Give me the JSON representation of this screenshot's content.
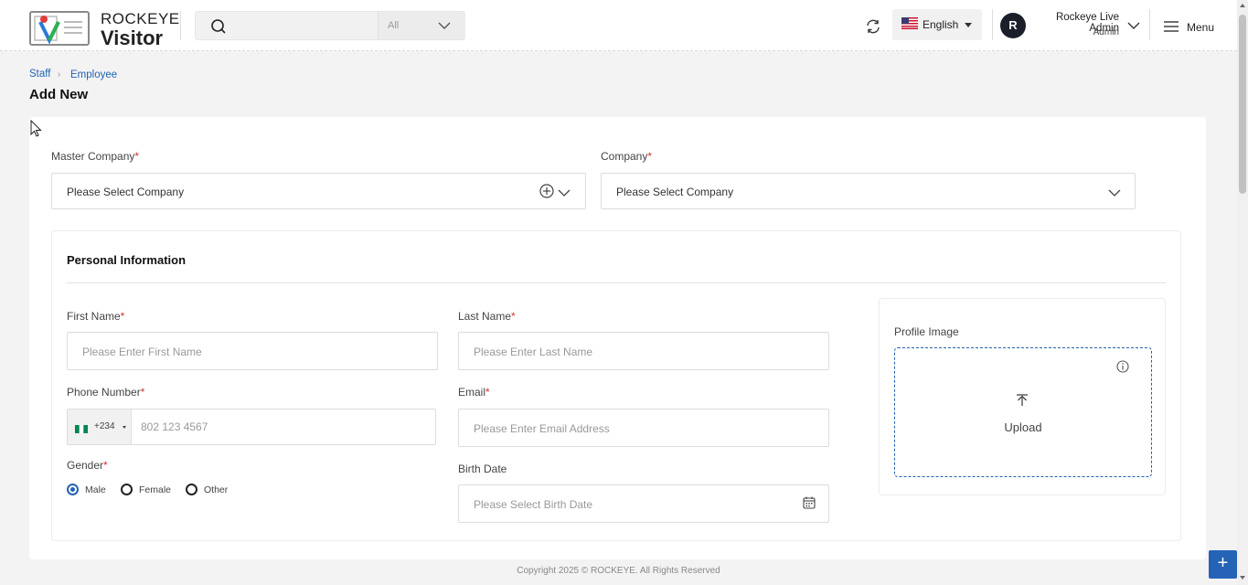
{
  "header": {
    "logo_line1": "ROCKEYE",
    "logo_line2": "Visitor",
    "search_placeholder": "",
    "search_filter": "All",
    "language": "English",
    "user_name": "Rockeye Live Admin",
    "user_role": "Admin",
    "avatar_initial": "R",
    "menu_label": "Menu"
  },
  "breadcrumb": {
    "item1": "Staff",
    "sep": "›",
    "item2": "Employee"
  },
  "page_title": "Add New",
  "form": {
    "master_company_label": "Master Company",
    "master_company_placeholder": "Please Select Company",
    "company_label": "Company",
    "company_placeholder": "Please Select Company",
    "required_mark": "*",
    "section_title": "Personal Information",
    "first_name_label": "First Name",
    "first_name_placeholder": "Please Enter First Name",
    "last_name_label": "Last Name",
    "last_name_placeholder": "Please Enter Last Name",
    "phone_label": "Phone Number",
    "dial_code": "+234",
    "phone_placeholder": "802 123 4567",
    "email_label": "Email",
    "email_placeholder": "Please Enter Email Address",
    "gender_label": "Gender",
    "gender_options": [
      "Male",
      "Female",
      "Other"
    ],
    "gender_selected": "Male",
    "birth_label": "Birth Date",
    "birth_placeholder": "Please Select Birth Date",
    "profile_label": "Profile Image",
    "upload_label": "Upload"
  },
  "footer": "Copyright 2025 © ROCKEYE. All Rights Reserved",
  "fab_label": "+",
  "colors": {
    "accent": "#2463b5",
    "required": "#d9342b"
  }
}
